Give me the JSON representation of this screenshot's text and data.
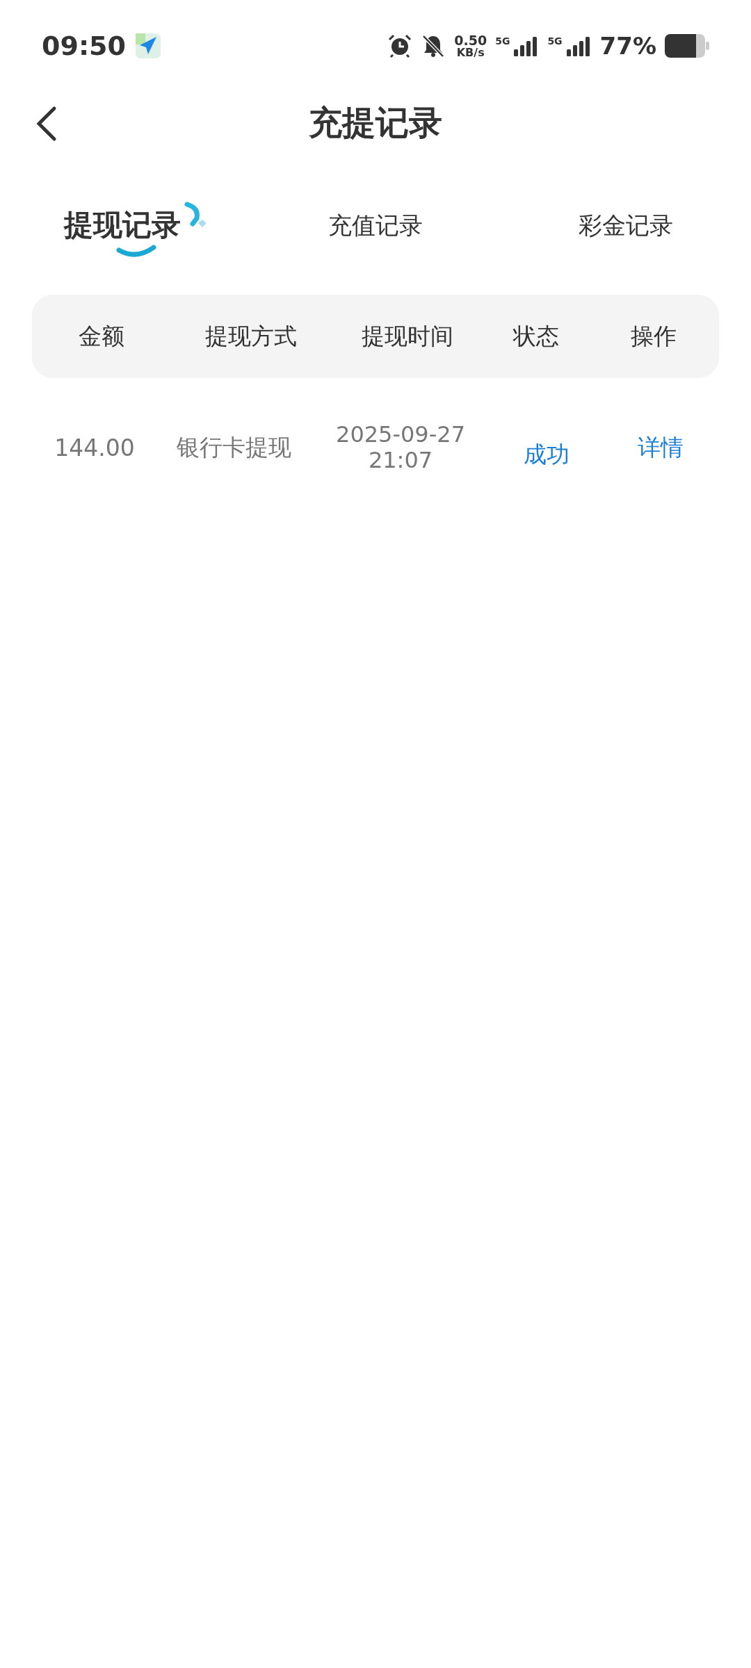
{
  "status_bar": {
    "time": "09:50",
    "net_speed": "0.50",
    "net_unit": "KB/s",
    "sim_labels": [
      "5G",
      "5G"
    ],
    "battery": "77%"
  },
  "header": {
    "title": "充提记录"
  },
  "tabs": [
    {
      "label": "提现记录",
      "selected": true
    },
    {
      "label": "充值记录",
      "selected": false
    },
    {
      "label": "彩金记录",
      "selected": false
    }
  ],
  "table": {
    "columns": [
      "金额",
      "提现方式",
      "提现时间",
      "状态",
      "操作"
    ],
    "rows": [
      {
        "cells": [
          {
            "kind": "plain",
            "text": "144.00"
          },
          {
            "kind": "plain",
            "text": "银行卡提现"
          },
          {
            "kind": "plain",
            "text": "2025-09-27 21:07"
          },
          {
            "kind": "status",
            "text": "成功"
          },
          {
            "kind": "link",
            "text": "详情"
          }
        ]
      }
    ]
  }
}
